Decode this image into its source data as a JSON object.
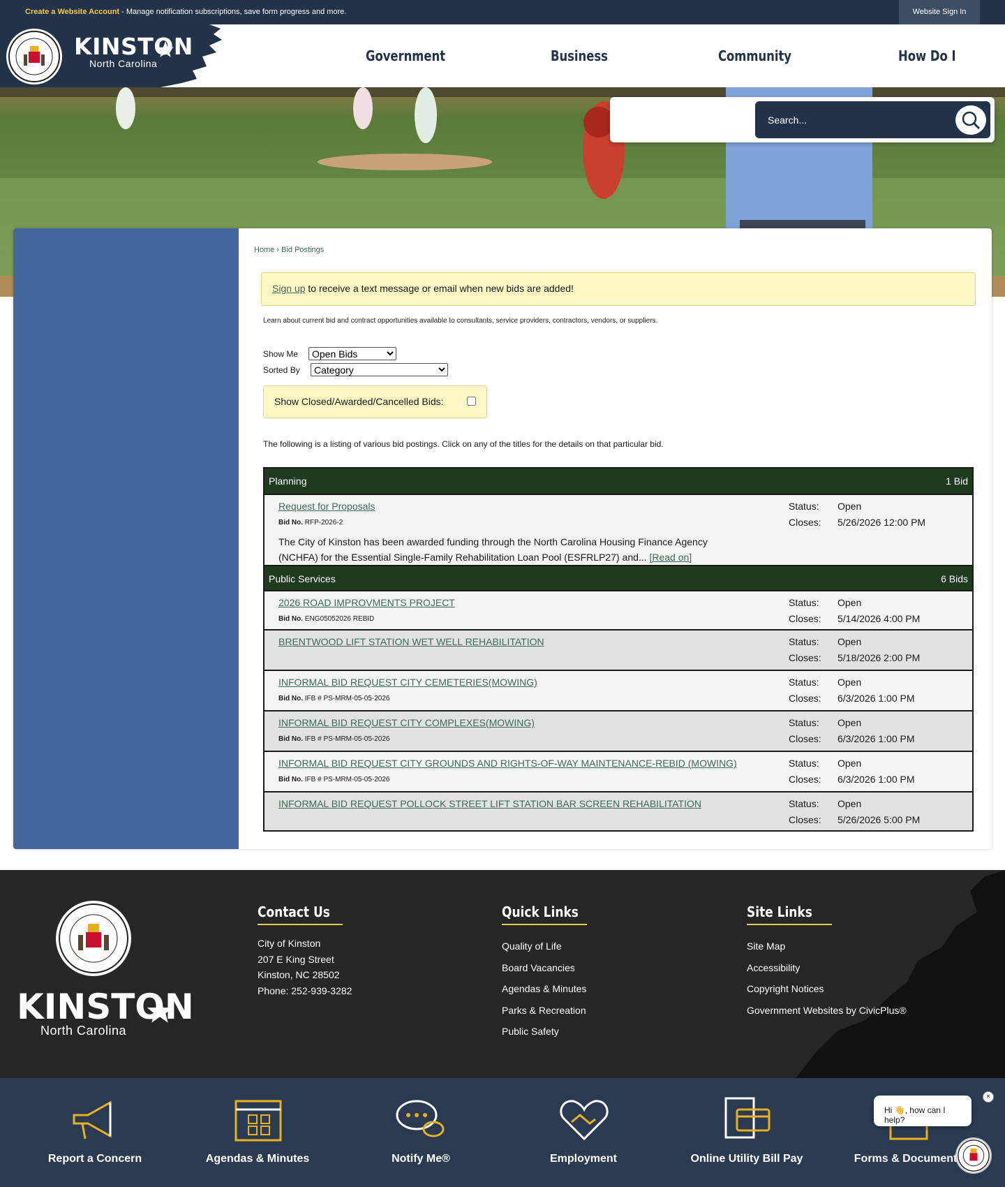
{
  "topbar": {
    "create_account": "Create a Website Account",
    "message": " - Manage notification subscriptions, save form progress and more.",
    "sign_in": "Website Sign In"
  },
  "logo": {
    "title": "KINSTON",
    "subtitle": "North Carolina"
  },
  "nav": [
    "Government",
    "Business",
    "Community",
    "How Do I"
  ],
  "search": {
    "placeholder": "Search..."
  },
  "breadcrumb": {
    "home": "Home",
    "sep": " › ",
    "current": "Bid Postings"
  },
  "notice": {
    "link": "Sign up",
    "text": " to receive a text message or email when new bids are added!"
  },
  "learn_text": "Learn about current bid and contract opportunities available to consultants, service providers, contractors, vendors, or suppliers.",
  "filters": {
    "show_me_label": "Show Me",
    "show_me_value": "Open Bids",
    "sorted_by_label": "Sorted By",
    "sorted_by_value": "Category",
    "closed_label": "Show Closed/Awarded/Cancelled Bids:"
  },
  "intro": "The following is a listing of various bid postings. Click on any of the titles for the details on that particular bid.",
  "bid_labels": {
    "bid_no": "Bid No.",
    "status": "Status:",
    "closes": "Closes:",
    "read_on": "[Read on]"
  },
  "categories": [
    {
      "name": "Planning",
      "count": "1 Bid",
      "bids": [
        {
          "title": "Request for Proposals",
          "bid_no": "RFP-2026-2",
          "status": "Open",
          "closes": "5/26/2026 12:00 PM",
          "desc_1": "The City of Kinston has been awarded funding through the North Carolina Housing Finance Agency",
          "desc_2": "(NCHFA) for the Essential Single-Family Rehabilitation Loan Pool (ESFRLP27) and... "
        }
      ]
    },
    {
      "name": "Public Services",
      "count": "6 Bids",
      "bids": [
        {
          "title": "2026 ROAD IMPROVMENTS PROJECT",
          "bid_no": "ENG05052026 REBID",
          "status": "Open",
          "closes": "5/14/2026 4:00 PM"
        },
        {
          "title": "BRENTWOOD LIFT STATION WET WELL REHABILITATION",
          "bid_no": "",
          "status": "Open",
          "closes": "5/18/2026 2:00 PM"
        },
        {
          "title": "INFORMAL BID REQUEST CITY CEMETERIES(MOWING)",
          "bid_no": "IFB # PS-MRM-05-05-2026",
          "status": "Open",
          "closes": "6/3/2026 1:00 PM"
        },
        {
          "title": "INFORMAL BID REQUEST CITY COMPLEXES(MOWING)",
          "bid_no": "IFB # PS-MRM-05-05-2026",
          "status": "Open",
          "closes": "6/3/2026 1:00 PM"
        },
        {
          "title": "INFORMAL BID REQUEST CITY GROUNDS AND RIGHTS-OF-WAY MAINTENANCE-REBID (MOWING)",
          "bid_no": "IFB # PS-MRM-05-05-2026",
          "status": "Open",
          "closes": "6/3/2026 1:00 PM"
        },
        {
          "title": "INFORMAL BID REQUEST POLLOCK STREET LIFT STATION BAR SCREEN REHABILITATION",
          "bid_no": "",
          "status": "Open",
          "closes": "5/26/2026 5:00 PM"
        }
      ]
    }
  ],
  "footer": {
    "logo_title": "KINSTON",
    "logo_subtitle": "North Carolina",
    "contact": {
      "heading": "Contact Us",
      "lines": [
        "City of Kinston",
        "207 E King Street",
        "Kinston, NC 28502",
        "Phone: 252-939-3282"
      ]
    },
    "quick_links": {
      "heading": "Quick Links",
      "items": [
        "Quality of Life",
        "Board Vacancies",
        "Agendas & Minutes",
        "Parks & Recreation",
        "Public Safety"
      ]
    },
    "site_links": {
      "heading": "Site Links",
      "items": [
        "Site Map",
        "Accessibility",
        "Copyright Notices",
        "Government Websites by CivicPlus®"
      ]
    }
  },
  "quickbar": [
    {
      "label": "Report a Concern",
      "icon": "megaphone-icon"
    },
    {
      "label": "Agendas & Minutes",
      "icon": "calendar-icon"
    },
    {
      "label": "Notify Me®",
      "icon": "chat-bubbles-icon"
    },
    {
      "label": "Employment",
      "icon": "handshake-icon"
    },
    {
      "label": "Online Utility Bill Pay",
      "icon": "bill-pay-icon"
    },
    {
      "label": "Forms & Documents",
      "icon": "documents-icon"
    }
  ],
  "chat": {
    "greeting": "Hi 👋, how can I help?",
    "close": "×"
  },
  "colors": {
    "navy": "#223349",
    "gold": "#f2c94c",
    "sidebar": "#44689b",
    "green": "#1e3a1f",
    "link": "#3e6b55"
  }
}
